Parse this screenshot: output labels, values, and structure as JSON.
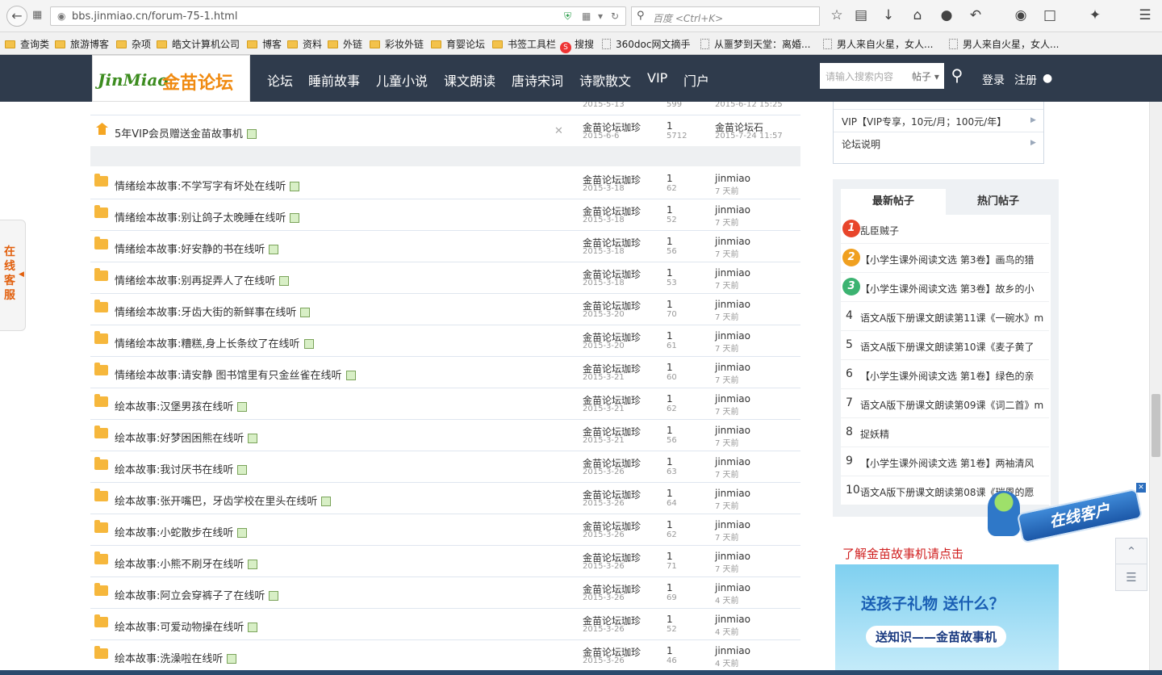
{
  "browser": {
    "url": "bbs.jinmiao.cn/forum-75-1.html",
    "search_placeholder": "百度 <Ctrl+K>",
    "bookmarks": [
      "查询类",
      "旅游博客",
      "杂项",
      "皓文计算机公司",
      "博客",
      "资料",
      "外链",
      "彩妆外链",
      "育婴论坛",
      "书签工具栏",
      "搜搜",
      "360doc网文摘手",
      "从噩梦到天堂：离婚...",
      "男人来自火星，女人...",
      "男人来自火星，女人..."
    ]
  },
  "site": {
    "logo_en": "JinMiao",
    "logo_cn": "金苗论坛",
    "nav": [
      "论坛",
      "睡前故事",
      "儿童小说",
      "课文朗读",
      "唐诗宋词",
      "诗歌散文",
      "VIP",
      "门户"
    ],
    "search_placeholder": "请输入搜索内容",
    "search_type": "帖子",
    "login": "登录",
    "register": "注册"
  },
  "threads": {
    "partial_row": {
      "author_date": "2015-5-13",
      "views": "599",
      "last_date": "2015-6-12 15:25"
    },
    "sticky": {
      "title": "5年VIP会员赠送金苗故事机",
      "author": "金苗论坛珈珍",
      "date": "2015-6-6",
      "replies": "1",
      "views": "5712",
      "last_user": "金苗论坛石",
      "last_date": "2015-7-24 11:57"
    },
    "rows": [
      {
        "title": "情绪绘本故事:不学写字有坏处在线听",
        "author": "金苗论坛珈珍",
        "date": "2015-3-18",
        "replies": "1",
        "views": "62",
        "last_user": "jinmiao",
        "last_date": "7 天前"
      },
      {
        "title": "情绪绘本故事:别让鸽子太晚睡在线听",
        "author": "金苗论坛珈珍",
        "date": "2015-3-18",
        "replies": "1",
        "views": "52",
        "last_user": "jinmiao",
        "last_date": "7 天前"
      },
      {
        "title": "情绪绘本故事:好安静的书在线听",
        "author": "金苗论坛珈珍",
        "date": "2015-3-18",
        "replies": "1",
        "views": "56",
        "last_user": "jinmiao",
        "last_date": "7 天前"
      },
      {
        "title": "情绪绘本故事:别再捉弄人了在线听",
        "author": "金苗论坛珈珍",
        "date": "2015-3-18",
        "replies": "1",
        "views": "53",
        "last_user": "jinmiao",
        "last_date": "7 天前"
      },
      {
        "title": "情绪绘本故事:牙齿大街的新鲜事在线听",
        "author": "金苗论坛珈珍",
        "date": "2015-3-20",
        "replies": "1",
        "views": "70",
        "last_user": "jinmiao",
        "last_date": "7 天前"
      },
      {
        "title": "情绪绘本故事:糟糕,身上长条纹了在线听",
        "author": "金苗论坛珈珍",
        "date": "2015-3-20",
        "replies": "1",
        "views": "61",
        "last_user": "jinmiao",
        "last_date": "7 天前"
      },
      {
        "title": "情绪绘本故事:请安静 图书馆里有只金丝雀在线听",
        "author": "金苗论坛珈珍",
        "date": "2015-3-21",
        "replies": "1",
        "views": "60",
        "last_user": "jinmiao",
        "last_date": "7 天前"
      },
      {
        "title": "绘本故事:汉堡男孩在线听",
        "author": "金苗论坛珈珍",
        "date": "2015-3-21",
        "replies": "1",
        "views": "62",
        "last_user": "jinmiao",
        "last_date": "7 天前"
      },
      {
        "title": "绘本故事:好梦困困熊在线听",
        "author": "金苗论坛珈珍",
        "date": "2015-3-21",
        "replies": "1",
        "views": "56",
        "last_user": "jinmiao",
        "last_date": "7 天前"
      },
      {
        "title": "绘本故事:我讨厌书在线听",
        "author": "金苗论坛珈珍",
        "date": "2015-3-26",
        "replies": "1",
        "views": "63",
        "last_user": "jinmiao",
        "last_date": "7 天前"
      },
      {
        "title": "绘本故事:张开嘴巴，牙齿学校在里头在线听",
        "author": "金苗论坛珈珍",
        "date": "2015-3-26",
        "replies": "1",
        "views": "64",
        "last_user": "jinmiao",
        "last_date": "7 天前"
      },
      {
        "title": "绘本故事:小蛇散步在线听",
        "author": "金苗论坛珈珍",
        "date": "2015-3-26",
        "replies": "1",
        "views": "62",
        "last_user": "jinmiao",
        "last_date": "7 天前"
      },
      {
        "title": "绘本故事:小熊不刷牙在线听",
        "author": "金苗论坛珈珍",
        "date": "2015-3-26",
        "replies": "1",
        "views": "71",
        "last_user": "jinmiao",
        "last_date": "7 天前"
      },
      {
        "title": "绘本故事:阿立会穿裤子了在线听",
        "author": "金苗论坛珈珍",
        "date": "2015-3-26",
        "replies": "1",
        "views": "69",
        "last_user": "jinmiao",
        "last_date": "4 天前"
      },
      {
        "title": "绘本故事:可爱动物操在线听",
        "author": "金苗论坛珈珍",
        "date": "2015-3-26",
        "replies": "1",
        "views": "52",
        "last_user": "jinmiao",
        "last_date": "4 天前"
      },
      {
        "title": "绘本故事:洗澡啦在线听",
        "author": "金苗论坛珈珍",
        "date": "2015-3-26",
        "replies": "1",
        "views": "46",
        "last_user": "jinmiao",
        "last_date": "4 天前"
      }
    ]
  },
  "sidebar": {
    "menu": [
      "VIP【VIP专享，10元/月；100元/年】",
      "论坛说明"
    ],
    "tabs": [
      "最新帖子",
      "热门帖子"
    ],
    "posts": [
      {
        "n": "1",
        "t": "乱臣贼子"
      },
      {
        "n": "2",
        "t": "【小学生课外阅读文选 第3卷】画鸟的猎"
      },
      {
        "n": "3",
        "t": "【小学生课外阅读文选 第3卷】故乡的小"
      },
      {
        "n": "4",
        "t": "语文A版下册课文朗读第11课《一碗水》m"
      },
      {
        "n": "5",
        "t": "语文A版下册课文朗读第10课《麦子黄了"
      },
      {
        "n": "6",
        "t": "【小学生课外阅读文选 第1卷】绿色的亲"
      },
      {
        "n": "7",
        "t": "语文A版下册课文朗读第09课《词二首》m"
      },
      {
        "n": "8",
        "t": "捉妖精"
      },
      {
        "n": "9",
        "t": "【小学生课外阅读文选 第1卷】两袖清风"
      },
      {
        "n": "10",
        "t": "语文A版下册课文朗读第08课《瑞恩的愿"
      }
    ],
    "learn_link": "了解金苗故事机请点击",
    "ad_line1": "送孩子礼物 送什么？",
    "ad_line2": "送知识——金苗故事机"
  },
  "floating": {
    "kefu": "在线客服",
    "online": "在线客户"
  },
  "colors": {
    "header_bg": "#2f3b4c",
    "accent_orange": "#f08a10",
    "link_red": "#d02020"
  }
}
